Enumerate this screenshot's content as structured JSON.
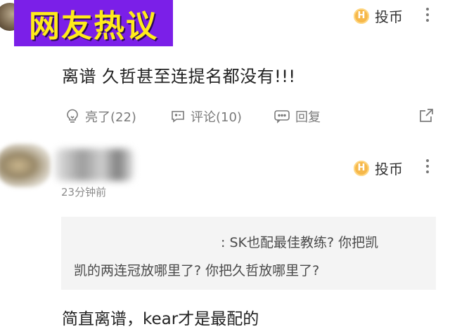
{
  "banner": {
    "text": "网友热议"
  },
  "comment1": {
    "coin_label": "投币",
    "text": "离谱 久哲甚至连提名都没有!!!",
    "actions": {
      "like": "亮了(22)",
      "comment": "评论(10)",
      "reply": "回复"
    }
  },
  "comment2": {
    "coin_label": "投币",
    "time": "23分钟前",
    "quote_line1": ": SK也配最佳教练? 你把凯",
    "quote_line2": "凯的两连冠放哪里了? 你把久哲放哪里了?",
    "text": "简直离谱，kear才是最配的"
  },
  "icons": {
    "coin": "coin-icon",
    "more": "more-vertical-icon",
    "like": "lightbulb-icon",
    "comment": "comment-bubble-icon",
    "reply": "reply-bubble-icon",
    "share": "share-icon"
  },
  "colors": {
    "banner_bg": "#7b1fe8",
    "banner_text": "#ffeb1a",
    "coin": "#f6b84a",
    "quote_bg": "#f4f4f4"
  }
}
